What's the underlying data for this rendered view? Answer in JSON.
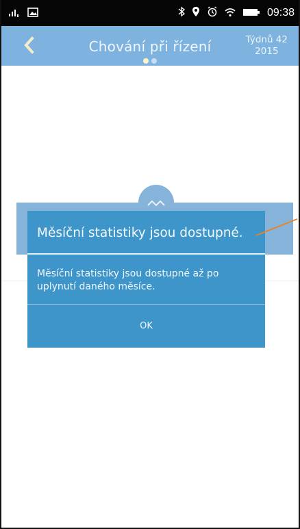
{
  "status_bar": {
    "time": "09:38"
  },
  "header": {
    "back_icon": "chevron-left-icon",
    "title": "Chování při řízení",
    "week_line1": "Týdnů 42",
    "week_line2": "2015",
    "active_dot_color": "#fff4c4",
    "inactive_dot_color": "#c8dff2"
  },
  "dialog": {
    "title": "Měsíční statistiky jsou dostupné.",
    "message": "Měsíční statistiky jsou dostupné až po uplynutí daného měsíce.",
    "ok_label": "OK"
  },
  "colors": {
    "header_bg": "#7fb3df",
    "dialog_bg": "#3d95c9",
    "annotation": "#e7842a"
  }
}
